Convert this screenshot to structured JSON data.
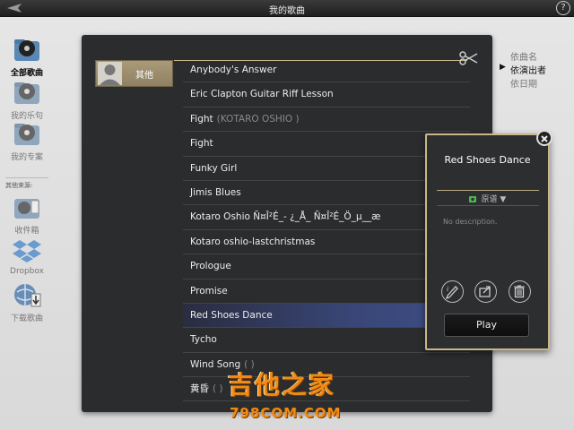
{
  "topbar": {
    "title": "我的歌曲"
  },
  "sidebar": {
    "items": [
      {
        "label": "全部歌曲",
        "icon": "cd-folder-icon"
      },
      {
        "label": "我的乐句",
        "icon": "cd-folder-icon"
      },
      {
        "label": "我的专案",
        "icon": "cd-folder-icon"
      },
      {
        "label": "收件箱",
        "icon": "inbox-folder-icon"
      },
      {
        "label": "Dropbox",
        "icon": "dropbox-icon"
      },
      {
        "label": "下载歌曲",
        "icon": "download-icon"
      }
    ],
    "section_label": "其他来源:"
  },
  "category": {
    "label": "其他"
  },
  "songs": [
    {
      "title": "Anybody's Answer",
      "extra": ""
    },
    {
      "title": "Eric Clapton Guitar Riff Lesson",
      "extra": ""
    },
    {
      "title": "Fight",
      "extra": "(KOTARO OSHIO )"
    },
    {
      "title": "Fight",
      "extra": ""
    },
    {
      "title": "Funky Girl",
      "extra": ""
    },
    {
      "title": "Jimis Blues",
      "extra": ""
    },
    {
      "title": "Kotaro Oshio Ñ¤Î²É_- ¿_Å_ Ñ¤Î²É_Ö_µ__æ",
      "extra": ""
    },
    {
      "title": "Kotaro oshio-lastchristmas",
      "extra": ""
    },
    {
      "title": "Prologue",
      "extra": ""
    },
    {
      "title": "Promise",
      "extra": ""
    },
    {
      "title": "Red Shoes Dance",
      "extra": ""
    },
    {
      "title": "Tycho",
      "extra": ""
    },
    {
      "title": "Wind Song",
      "extra": "( )"
    },
    {
      "title": "黄昏",
      "extra": "( )"
    }
  ],
  "sort": {
    "options": [
      "依曲名",
      "依演出者",
      "依日期"
    ],
    "active_index": 1
  },
  "popup": {
    "song_title": "Red Shoes Dance",
    "version": "原谱 ▼",
    "description": "No description.",
    "play_label": "Play"
  },
  "watermark": {
    "cn": "吉他之家",
    "en": "798COM.COM"
  },
  "colors": {
    "accent_gold": "#c9b78a",
    "selected_row": "#3f4d85",
    "panel_bg": "#2b2c2e"
  }
}
